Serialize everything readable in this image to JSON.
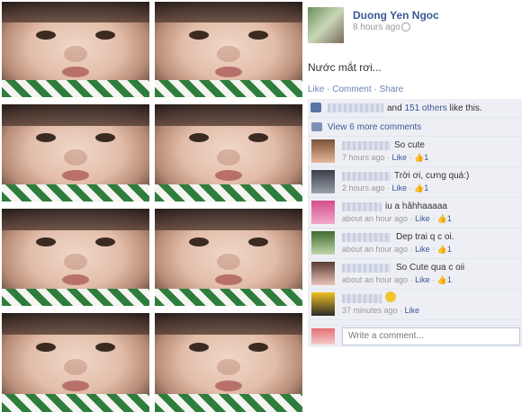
{
  "post": {
    "poster_name": "Duong Yen Ngoc",
    "time": "8 hours ago",
    "status_text": "Nước mắt rơi...",
    "actions": {
      "like": "Like",
      "comment": "Comment",
      "share": "Share"
    }
  },
  "likes": {
    "and": "and",
    "others": "151 others",
    "suffix": "like this."
  },
  "view_more": "View 6 more comments",
  "comments": [
    {
      "text": "So cute",
      "time": "7 hours ago",
      "like": "Like",
      "likes": "1"
    },
    {
      "text": "Trời ơi, cưng quá:)",
      "time": "2 hours ago",
      "like": "Like",
      "likes": "1"
    },
    {
      "text": "iu a hâhhaaaaa",
      "time": "about an hour ago",
      "like": "Like",
      "likes": "1"
    },
    {
      "text": "Dep trai q c oi.",
      "time": "about an hour ago",
      "like": "Like",
      "likes": "1"
    },
    {
      "text": "So Cute qua c oii",
      "time": "about an hour ago",
      "like": "Like",
      "likes": "1"
    },
    {
      "text": "",
      "time": "37 minutes ago",
      "like": "Like",
      "likes": ""
    }
  ],
  "write_placeholder": "Write a comment...",
  "colors": {
    "fb_blue": "#3b5998",
    "comment_bg": "#edeff4"
  }
}
